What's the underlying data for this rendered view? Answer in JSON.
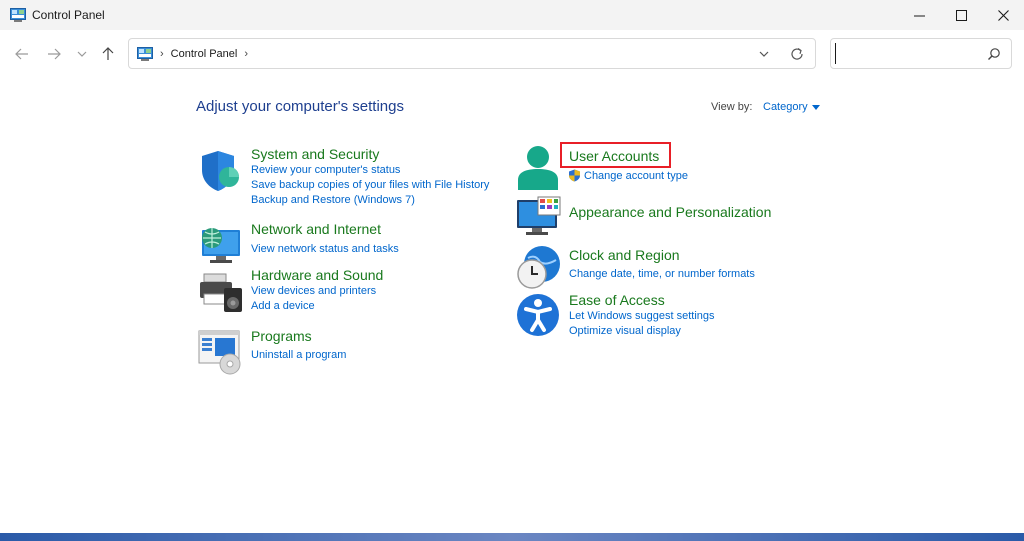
{
  "window": {
    "title": "Control Panel",
    "minimize_label": "—",
    "maximize_label": "☐",
    "close_label": "✕"
  },
  "nav": {
    "back_icon": "arrow-left-icon",
    "forward_icon": "arrow-right-icon",
    "recent_icon": "chevron-down-icon",
    "up_icon": "arrow-up-icon",
    "breadcrumb_sep": "›",
    "breadcrumb": [
      "Control Panel"
    ],
    "search_value": "",
    "search_placeholder": ""
  },
  "main": {
    "title": "Adjust your computer's settings",
    "view_by_label": "View by:",
    "view_by_value": "Category",
    "left": [
      {
        "name": "System and Security",
        "icon": "shield-icon",
        "links": [
          "Review your computer's status",
          "Save backup copies of your files with File History",
          "Backup and Restore (Windows 7)"
        ]
      },
      {
        "name": "Network and Internet",
        "icon": "globe-monitor-icon",
        "links": [
          "View network status and tasks"
        ]
      },
      {
        "name": "Hardware and Sound",
        "icon": "printer-speaker-icon",
        "links": [
          "View devices and printers",
          "Add a device"
        ]
      },
      {
        "name": "Programs",
        "icon": "programs-icon",
        "links": [
          "Uninstall a program"
        ]
      }
    ],
    "right": [
      {
        "name": "User Accounts",
        "icon": "user-icon",
        "links": [
          "Change account type"
        ]
      },
      {
        "name": "Appearance and Personalization",
        "icon": "monitor-palette-icon",
        "links": []
      },
      {
        "name": "Clock and Region",
        "icon": "clock-globe-icon",
        "links": [
          "Change date, time, or number formats"
        ]
      },
      {
        "name": "Ease of Access",
        "icon": "accessibility-icon",
        "links": [
          "Let Windows suggest settings",
          "Optimize visual display"
        ]
      }
    ]
  },
  "colors": {
    "category_name": "#19791d",
    "link": "#0066cc",
    "title": "#1e3f8f",
    "highlight": "#e81f27"
  }
}
